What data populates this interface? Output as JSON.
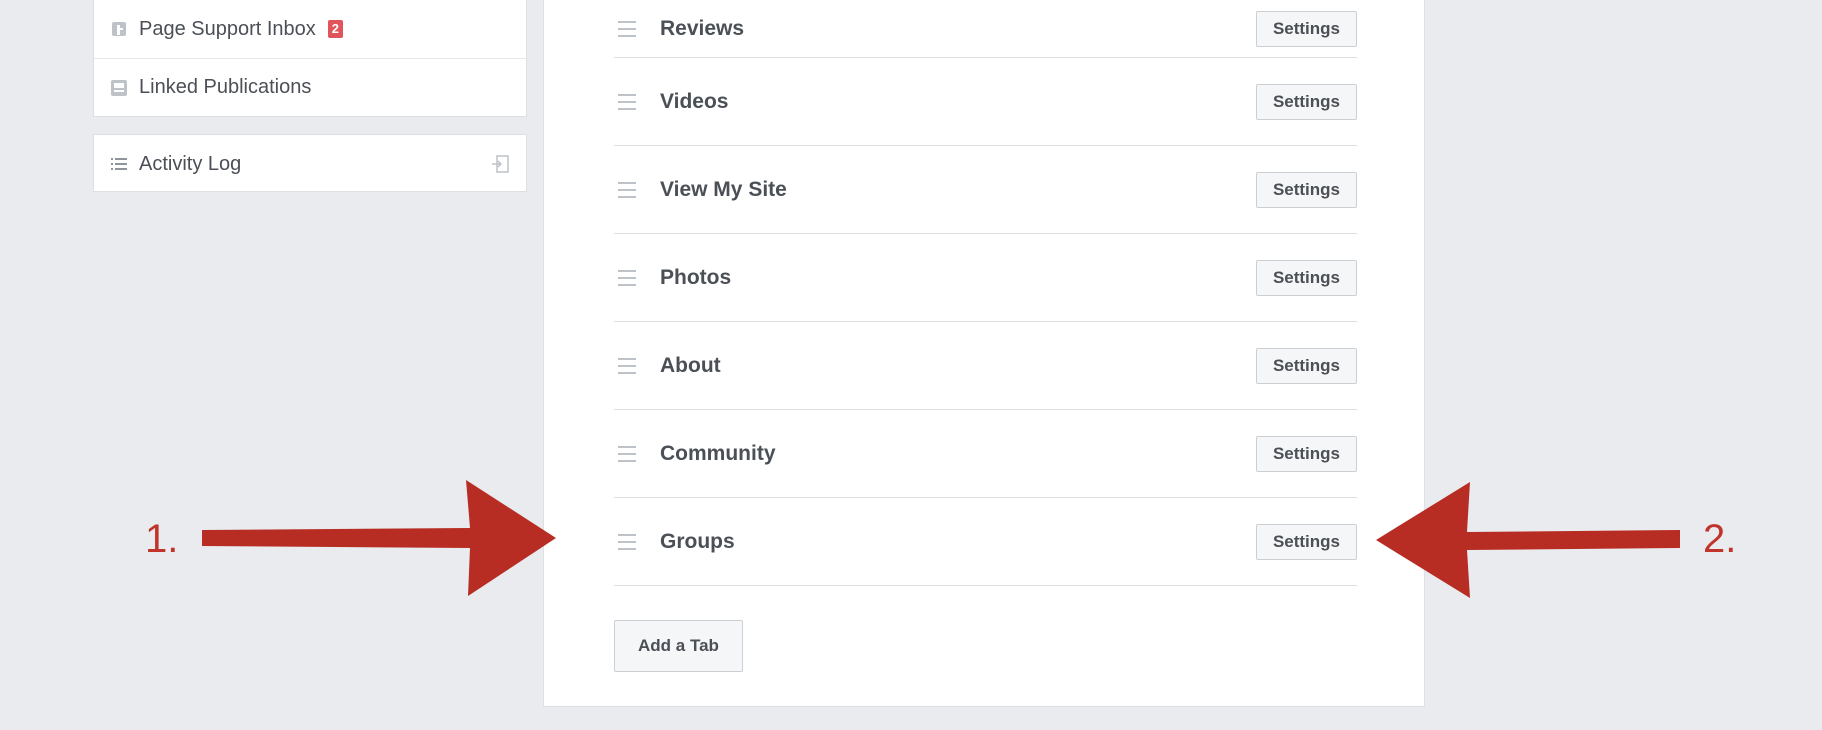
{
  "sidebar": {
    "items": [
      {
        "label": "Page Support Inbox",
        "icon": "page-support-icon",
        "badge": "2"
      },
      {
        "label": "Linked Publications",
        "icon": "publication-icon"
      }
    ],
    "activity_log": {
      "label": "Activity Log",
      "icon": "list-icon",
      "action_icon": "exit-icon"
    }
  },
  "tabs": [
    {
      "label": "Reviews",
      "button": "Settings"
    },
    {
      "label": "Videos",
      "button": "Settings"
    },
    {
      "label": "View My Site",
      "button": "Settings"
    },
    {
      "label": "Photos",
      "button": "Settings"
    },
    {
      "label": "About",
      "button": "Settings"
    },
    {
      "label": "Community",
      "button": "Settings"
    },
    {
      "label": "Groups",
      "button": "Settings"
    }
  ],
  "add_tab_label": "Add a Tab",
  "annotations": {
    "left": "1.",
    "right": "2.",
    "color": "#b82d23"
  },
  "colors": {
    "background": "#e9ebee",
    "badge": "#e0555a"
  }
}
